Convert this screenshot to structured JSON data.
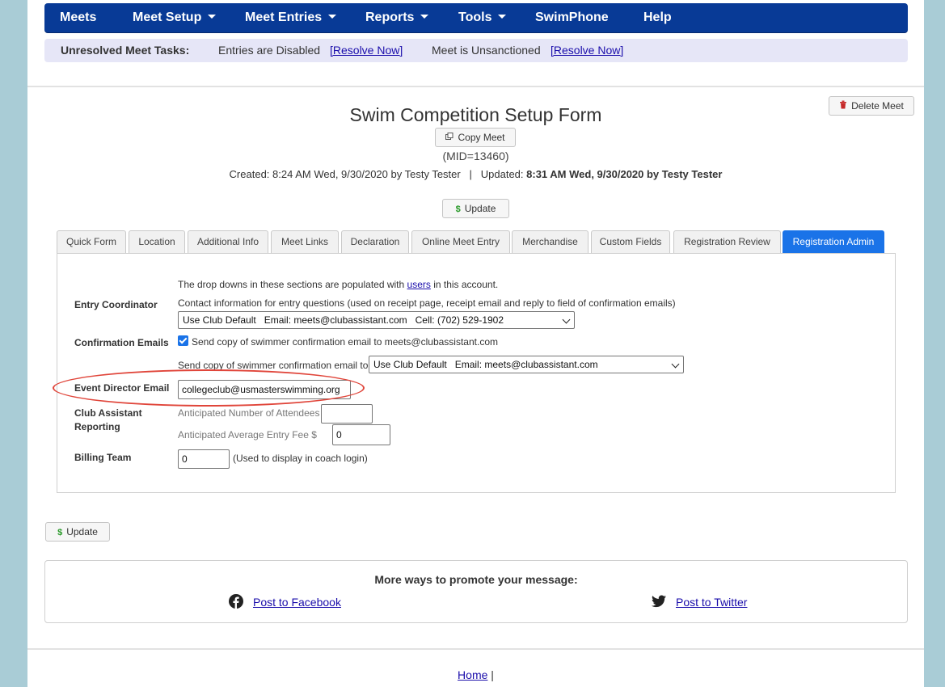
{
  "nav": {
    "items": [
      {
        "label": "Meets",
        "dropdown": false
      },
      {
        "label": "Meet Setup",
        "dropdown": true
      },
      {
        "label": "Meet Entries",
        "dropdown": true
      },
      {
        "label": "Reports",
        "dropdown": true
      },
      {
        "label": "Tools",
        "dropdown": true
      },
      {
        "label": "SwimPhone",
        "dropdown": false
      },
      {
        "label": "Help",
        "dropdown": false
      }
    ]
  },
  "tasks": {
    "label": "Unresolved Meet Tasks:",
    "task1": "Entries are Disabled",
    "task1_link": "[Resolve Now]",
    "task2": "Meet is Unsanctioned",
    "task2_link": "[Resolve Now]"
  },
  "header": {
    "title": "Swim Competition Setup Form",
    "copy_button": "Copy Meet",
    "delete_button": "Delete Meet",
    "mid": "(MID=13460)",
    "created_prefix": "Created: 8:24 AM Wed, 9/30/2020 by Testy Tester   |   Updated: ",
    "updated_value": "8:31 AM Wed, 9/30/2020 by Testy Tester",
    "update_button": "Update"
  },
  "tabs": [
    {
      "label": "Quick Form",
      "active": false
    },
    {
      "label": "Location",
      "active": false
    },
    {
      "label": "Additional Info",
      "active": false
    },
    {
      "label": "Meet Links",
      "active": false
    },
    {
      "label": "Declaration",
      "active": false
    },
    {
      "label": "Online Meet Entry",
      "active": false
    },
    {
      "label": "Merchandise",
      "active": false
    },
    {
      "label": "Custom Fields",
      "active": false
    },
    {
      "label": "Registration Review",
      "active": false
    },
    {
      "label": "Registration Admin",
      "active": true
    }
  ],
  "form": {
    "intro_before": "The drop downs in these sections are populated with ",
    "intro_link": "users",
    "intro_after": " in this account.",
    "entry_coordinator_label": "Entry Coordinator",
    "entry_coordinator_desc": "Contact information for entry questions (used on receipt page, receipt email and reply to field of confirmation emails)",
    "entry_coordinator_value": "Use Club Default   Email: meets@clubassistant.com   Cell: (702) 529-1902",
    "confirmation_label": "Confirmation Emails",
    "confirmation_checkbox_text": "Send copy of swimmer confirmation email to meets@clubassistant.com",
    "confirmation_checked": true,
    "send_copy_text": "Send copy of swimmer confirmation email to",
    "send_copy_value": "Use Club Default   Email: meets@clubassistant.com",
    "event_director_label": "Event Director Email",
    "event_director_value": "collegeclub@usmasterswimming.org",
    "club_assistant_label": "Club Assistant Reporting",
    "attendees_label": "Anticipated Number of Attendees",
    "attendees_value": "",
    "avg_fee_label": "Anticipated Average Entry Fee $",
    "avg_fee_value": "0",
    "billing_label": "Billing Team",
    "billing_value": "0",
    "billing_hint": "(Used to display in coach login)"
  },
  "bottom_update": "Update",
  "promo": {
    "title": "More ways to promote your message:",
    "facebook": "Post to Facebook",
    "twitter": "Post to Twitter"
  },
  "footer": {
    "home": "Home",
    "sep": "|"
  },
  "colors": {
    "nav_bg": "#083a96",
    "active_tab": "#1a73e8",
    "highlight": "#e0453a",
    "page_bg": "#a9ccd6"
  }
}
